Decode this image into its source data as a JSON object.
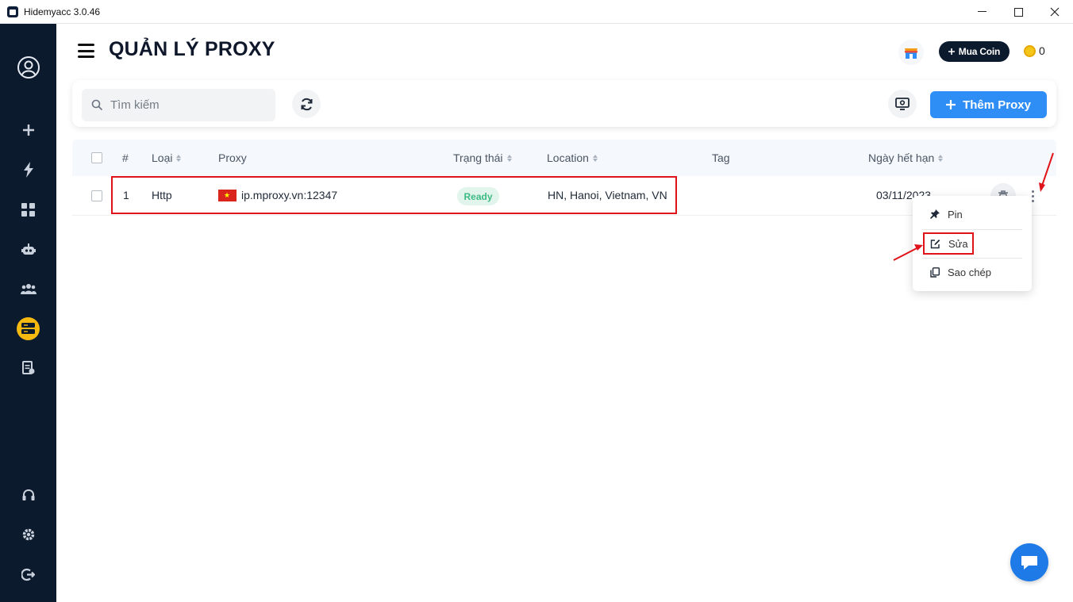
{
  "window": {
    "title": "Hidemyacc 3.0.46",
    "controls": [
      "—",
      "☐",
      "✕"
    ]
  },
  "sidebar": {
    "items": [
      {
        "icon": "user-circle-icon"
      },
      {
        "icon": "plus-icon"
      },
      {
        "icon": "lightning-icon"
      },
      {
        "icon": "grid-icon"
      },
      {
        "icon": "robot-icon"
      },
      {
        "icon": "team-icon"
      },
      {
        "icon": "server-icon",
        "active": true,
        "active_color": "#f5b90f"
      },
      {
        "icon": "document-icon"
      },
      {
        "icon": "headset-icon"
      },
      {
        "icon": "gear-icon"
      },
      {
        "icon": "logout-icon"
      }
    ]
  },
  "header": {
    "title": "QUẢN LÝ PROXY",
    "buy_coin_label": "Mua Coin",
    "coin_count": "0"
  },
  "toolbar": {
    "search_placeholder": "Tìm kiếm",
    "add_proxy_label": "Thêm Proxy"
  },
  "table": {
    "columns": {
      "index": "#",
      "type": "Loại",
      "proxy": "Proxy",
      "status": "Trạng thái",
      "location": "Location",
      "tag": "Tag",
      "expiry": "Ngày hết hạn"
    },
    "rows": [
      {
        "index": "1",
        "type": "Http",
        "proxy": "ip.mproxy.vn:12347",
        "flag": "vietnam-flag-icon",
        "status": "Ready",
        "location": "HN, Hanoi, Vietnam, VN",
        "tag": "",
        "expiry": "03/11/2023"
      }
    ]
  },
  "context_menu": {
    "items": [
      {
        "label": "Pin",
        "icon": "pin-icon"
      },
      {
        "label": "Sửa",
        "icon": "edit-icon"
      },
      {
        "label": "Sao chép",
        "icon": "copy-icon"
      }
    ]
  },
  "colors": {
    "sidebar_bg": "#0c1a2e",
    "accent_blue": "#2e8ef6",
    "status_ready": "#3dbb83",
    "highlight_red": "#e0131b"
  }
}
